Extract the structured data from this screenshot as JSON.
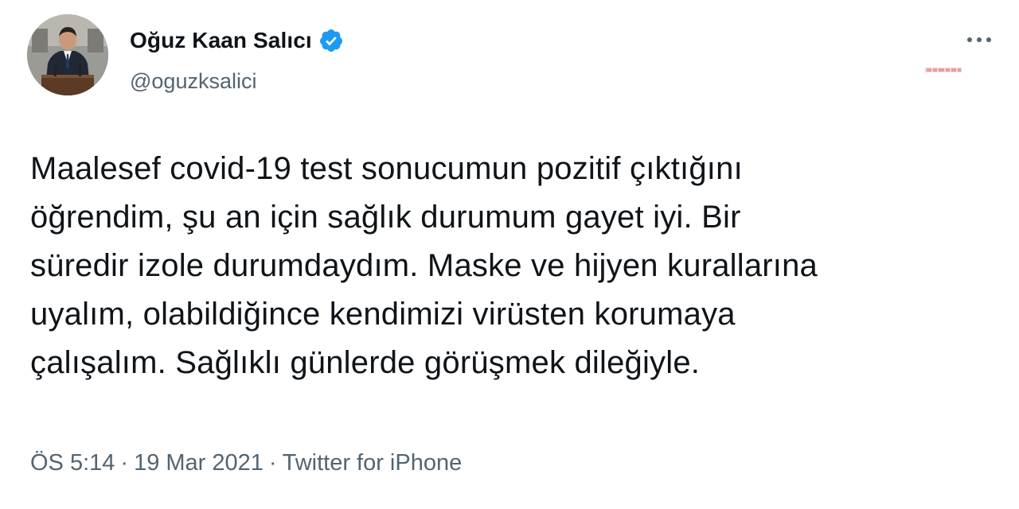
{
  "author": {
    "display_name": "Oğuz Kaan Salıcı",
    "handle": "@oguzksalici",
    "verified": true,
    "avatar_icon": "profile-photo-speaker-at-podium"
  },
  "tweet": {
    "text": "Maalesef covid-19 test sonucumun pozitif çıktığını\nöğrendim, şu an için sağlık durumum gayet iyi. Bir\nsüredir izole durumdaydım. Maske ve hijyen kurallarına\nuyalım, olabildiğince kendimizi virüsten korumaya\nçalışalım. Sağlıklı günlerde görüşmek dileğiyle.",
    "time": "ÖS 5:14",
    "date": "19 Mar 2021",
    "separator": "·",
    "source": "Twitter for iPhone"
  },
  "icons": {
    "more": "more-horizontal-icon",
    "verified": "verified-badge-icon"
  },
  "colors": {
    "verified_blue": "#1d9bf0",
    "secondary_text": "#536471",
    "primary_text": "#0f1419",
    "watermark_red": "#e3a0a0"
  }
}
